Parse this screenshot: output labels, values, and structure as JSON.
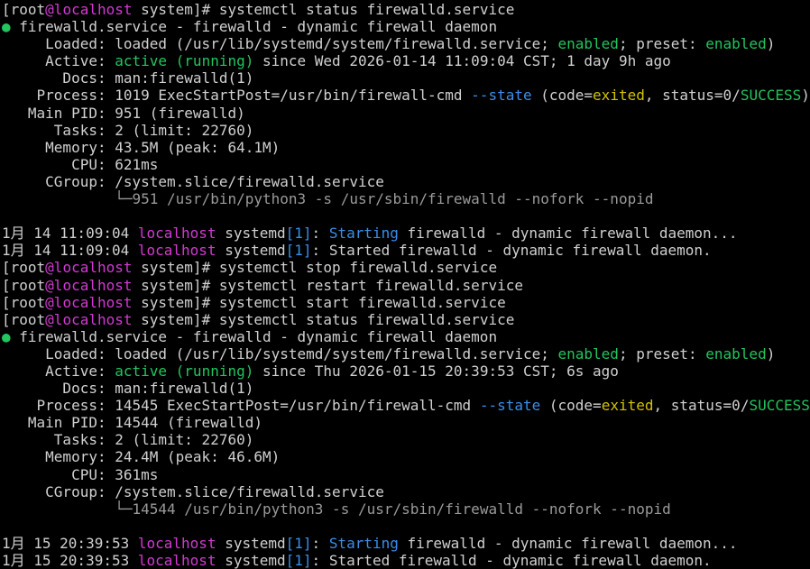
{
  "colors": {
    "background": "#000000",
    "text": "#d0d0d0",
    "host": "#d23ad2",
    "ok": "#22c55e",
    "info": "#3b8eea",
    "warn": "#d4c200",
    "dim": "#9a9a9a"
  },
  "lines": [
    [
      {
        "t": "[root"
      },
      {
        "t": "@localhost",
        "c": "mag"
      },
      {
        "t": " system]# systemctl status firewalld.service"
      }
    ],
    [
      {
        "t": "● ",
        "c": "grn"
      },
      {
        "t": "firewalld.service - firewalld - dynamic firewall daemon"
      }
    ],
    [
      {
        "t": "     Loaded: loaded (/usr/lib/systemd/system/firewalld.service; "
      },
      {
        "t": "enabled",
        "c": "grn"
      },
      {
        "t": "; preset: "
      },
      {
        "t": "enabled",
        "c": "grn"
      },
      {
        "t": ")"
      }
    ],
    [
      {
        "t": "     Active: "
      },
      {
        "t": "active (running)",
        "c": "grn"
      },
      {
        "t": " since Wed 2026-01-14 11:09:04 CST; 1 day 9h ago"
      }
    ],
    [
      {
        "t": "       Docs: man:firewalld(1)"
      }
    ],
    [
      {
        "t": "    Process: 1019 ExecStartPost=/usr/bin/firewall-cmd "
      },
      {
        "t": "--state",
        "c": "blu"
      },
      {
        "t": " (code="
      },
      {
        "t": "exited",
        "c": "yel"
      },
      {
        "t": ", status=0/"
      },
      {
        "t": "SUCCESS",
        "c": "grn"
      },
      {
        "t": ")"
      }
    ],
    [
      {
        "t": "   Main PID: 951 (firewalld)"
      }
    ],
    [
      {
        "t": "      Tasks: 2 (limit: 22760)"
      }
    ],
    [
      {
        "t": "     Memory: 43.5M (peak: 64.1M)"
      }
    ],
    [
      {
        "t": "        CPU: 621ms"
      }
    ],
    [
      {
        "t": "     CGroup: /system.slice/firewalld.service"
      }
    ],
    [
      {
        "t": "             └─",
        "c": "gry"
      },
      {
        "t": "951 /usr/bin/python3 -s /usr/sbin/firewalld --nofork --nopid",
        "c": "gry"
      }
    ],
    [
      {
        "t": ""
      }
    ],
    [
      {
        "t": "1月 14 11:09:04 "
      },
      {
        "t": "localhost",
        "c": "mag"
      },
      {
        "t": " systemd"
      },
      {
        "t": "[1]",
        "c": "blu"
      },
      {
        "t": ": "
      },
      {
        "t": "Starting",
        "c": "blu"
      },
      {
        "t": " firewalld - dynamic firewall daemon..."
      }
    ],
    [
      {
        "t": "1月 14 11:09:04 "
      },
      {
        "t": "localhost",
        "c": "mag"
      },
      {
        "t": " systemd"
      },
      {
        "t": "[1]",
        "c": "blu"
      },
      {
        "t": ": Started firewalld - dynamic firewall daemon."
      }
    ],
    [
      {
        "t": "[root"
      },
      {
        "t": "@localhost",
        "c": "mag"
      },
      {
        "t": " system]# systemctl stop firewalld.service"
      }
    ],
    [
      {
        "t": "[root"
      },
      {
        "t": "@localhost",
        "c": "mag"
      },
      {
        "t": " system]# systemctl restart firewalld.service"
      }
    ],
    [
      {
        "t": "[root"
      },
      {
        "t": "@localhost",
        "c": "mag"
      },
      {
        "t": " system]# systemctl start firewalld.service"
      }
    ],
    [
      {
        "t": "[root"
      },
      {
        "t": "@localhost",
        "c": "mag"
      },
      {
        "t": " system]# systemctl status firewalld.service"
      }
    ],
    [
      {
        "t": "● ",
        "c": "grn"
      },
      {
        "t": "firewalld.service - firewalld - dynamic firewall daemon"
      }
    ],
    [
      {
        "t": "     Loaded: loaded (/usr/lib/systemd/system/firewalld.service; "
      },
      {
        "t": "enabled",
        "c": "grn"
      },
      {
        "t": "; preset: "
      },
      {
        "t": "enabled",
        "c": "grn"
      },
      {
        "t": ")"
      }
    ],
    [
      {
        "t": "     Active: "
      },
      {
        "t": "active (running)",
        "c": "grn"
      },
      {
        "t": " since Thu 2026-01-15 20:39:53 CST; 6s ago"
      }
    ],
    [
      {
        "t": "       Docs: man:firewalld(1)"
      }
    ],
    [
      {
        "t": "    Process: 14545 ExecStartPost=/usr/bin/firewall-cmd "
      },
      {
        "t": "--state",
        "c": "blu"
      },
      {
        "t": " (code="
      },
      {
        "t": "exited",
        "c": "yel"
      },
      {
        "t": ", status=0/"
      },
      {
        "t": "SUCCESS",
        "c": "grn"
      },
      {
        "t": ")"
      }
    ],
    [
      {
        "t": "   Main PID: 14544 (firewalld)"
      }
    ],
    [
      {
        "t": "      Tasks: 2 (limit: 22760)"
      }
    ],
    [
      {
        "t": "     Memory: 24.4M (peak: 46.6M)"
      }
    ],
    [
      {
        "t": "        CPU: 361ms"
      }
    ],
    [
      {
        "t": "     CGroup: /system.slice/firewalld.service"
      }
    ],
    [
      {
        "t": "             └─",
        "c": "gry"
      },
      {
        "t": "14544 /usr/bin/python3 -s /usr/sbin/firewalld --nofork --nopid",
        "c": "gry"
      }
    ],
    [
      {
        "t": ""
      }
    ],
    [
      {
        "t": "1月 15 20:39:53 "
      },
      {
        "t": "localhost",
        "c": "mag"
      },
      {
        "t": " systemd"
      },
      {
        "t": "[1]",
        "c": "blu"
      },
      {
        "t": ": "
      },
      {
        "t": "Starting",
        "c": "blu"
      },
      {
        "t": " firewalld - dynamic firewall daemon..."
      }
    ],
    [
      {
        "t": "1月 15 20:39:53 "
      },
      {
        "t": "localhost",
        "c": "mag"
      },
      {
        "t": " systemd"
      },
      {
        "t": "[1]",
        "c": "blu"
      },
      {
        "t": ": Started firewalld - dynamic firewall daemon."
      }
    ]
  ]
}
